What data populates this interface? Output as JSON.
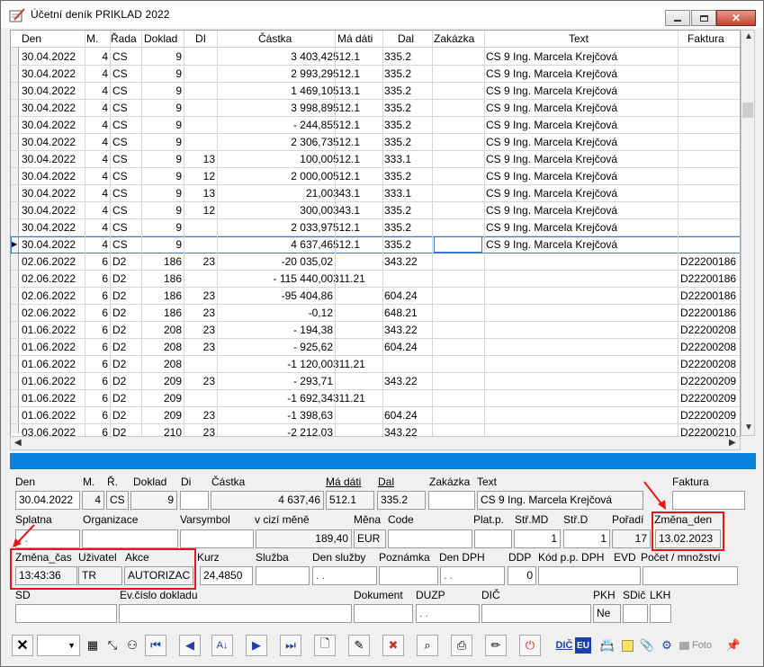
{
  "window": {
    "title": "Účetní deník  PRIKLAD    2022"
  },
  "grid": {
    "columns": [
      "Den",
      "M.",
      "Řada",
      "Doklad",
      "DI",
      "Částka",
      "Má dáti",
      "Dal",
      "Zakázka",
      "Text",
      "Faktura"
    ],
    "rows": [
      [
        "30.04.2022",
        "4",
        "CS",
        "9",
        "",
        "3 403,42",
        "512.1",
        "335.2",
        "",
        "CS 9 Ing. Marcela Krejčová",
        ""
      ],
      [
        "30.04.2022",
        "4",
        "CS",
        "9",
        "",
        "2 993,29",
        "512.1",
        "335.2",
        "",
        "CS 9 Ing. Marcela Krejčová",
        ""
      ],
      [
        "30.04.2022",
        "4",
        "CS",
        "9",
        "",
        "1 469,10",
        "513.1",
        "335.2",
        "",
        "CS 9 Ing. Marcela Krejčová",
        ""
      ],
      [
        "30.04.2022",
        "4",
        "CS",
        "9",
        "",
        "3 998,89",
        "512.1",
        "335.2",
        "",
        "CS 9 Ing. Marcela Krejčová",
        ""
      ],
      [
        "30.04.2022",
        "4",
        "CS",
        "9",
        "",
        "- 244,85",
        "512.1",
        "335.2",
        "",
        "CS 9 Ing. Marcela Krejčová",
        ""
      ],
      [
        "30.04.2022",
        "4",
        "CS",
        "9",
        "",
        "2 306,73",
        "512.1",
        "335.2",
        "",
        "CS 9 Ing. Marcela Krejčová",
        ""
      ],
      [
        "30.04.2022",
        "4",
        "CS",
        "9",
        "13",
        "100,00",
        "512.1",
        "333.1",
        "",
        "CS 9 Ing. Marcela Krejčová",
        ""
      ],
      [
        "30.04.2022",
        "4",
        "CS",
        "9",
        "12",
        "2 000,00",
        "512.1",
        "335.2",
        "",
        "CS 9 Ing. Marcela Krejčová",
        ""
      ],
      [
        "30.04.2022",
        "4",
        "CS",
        "9",
        "13",
        "21,00",
        "343.1",
        "333.1",
        "",
        "CS 9 Ing. Marcela Krejčová",
        ""
      ],
      [
        "30.04.2022",
        "4",
        "CS",
        "9",
        "12",
        "300,00",
        "343.1",
        "335.2",
        "",
        "CS 9 Ing. Marcela Krejčová",
        ""
      ],
      [
        "30.04.2022",
        "4",
        "CS",
        "9",
        "",
        "2 033,97",
        "512.1",
        "335.2",
        "",
        "CS 9 Ing. Marcela Krejčová",
        ""
      ],
      [
        "30.04.2022",
        "4",
        "CS",
        "9",
        "",
        "4 637,46",
        "512.1",
        "335.2",
        "",
        "CS 9 Ing. Marcela Krejčová",
        ""
      ],
      [
        "02.06.2022",
        "6",
        "D2",
        "186",
        "23",
        "-20 035,02",
        "",
        "343.22",
        "",
        "",
        "D22200186"
      ],
      [
        "02.06.2022",
        "6",
        "D2",
        "186",
        "",
        "- 115 440,00",
        "311.21",
        "",
        "",
        "",
        "D22200186"
      ],
      [
        "02.06.2022",
        "6",
        "D2",
        "186",
        "23",
        "-95 404,86",
        "",
        "604.24",
        "",
        "",
        "D22200186"
      ],
      [
        "02.06.2022",
        "6",
        "D2",
        "186",
        "23",
        "-0,12",
        "",
        "648.21",
        "",
        "",
        "D22200186"
      ],
      [
        "01.06.2022",
        "6",
        "D2",
        "208",
        "23",
        "- 194,38",
        "",
        "343.22",
        "",
        "",
        "D22200208"
      ],
      [
        "01.06.2022",
        "6",
        "D2",
        "208",
        "23",
        "- 925,62",
        "",
        "604.24",
        "",
        "",
        "D22200208"
      ],
      [
        "01.06.2022",
        "6",
        "D2",
        "208",
        "",
        "-1 120,00",
        "311.21",
        "",
        "",
        "",
        "D22200208"
      ],
      [
        "01.06.2022",
        "6",
        "D2",
        "209",
        "23",
        "- 293,71",
        "",
        "343.22",
        "",
        "",
        "D22200209"
      ],
      [
        "01.06.2022",
        "6",
        "D2",
        "209",
        "",
        "-1 692,34",
        "311.21",
        "",
        "",
        "",
        "D22200209"
      ],
      [
        "01.06.2022",
        "6",
        "D2",
        "209",
        "23",
        "-1 398,63",
        "",
        "604.24",
        "",
        "",
        "D22200209"
      ],
      [
        "03.06.2022",
        "6",
        "D2",
        "210",
        "23",
        "-2 212,03",
        "",
        "343.22",
        "",
        "",
        "D22200210"
      ]
    ],
    "current_row_index": 11
  },
  "form": {
    "labels": {
      "den": "Den",
      "m": "M.",
      "r": "Ř.",
      "doklad": "Doklad",
      "di": "Di",
      "castka": "Částka",
      "madati": "Má dáti",
      "dal": "Dal",
      "zakazka": "Zakázka",
      "text": "Text",
      "faktura": "Faktura",
      "splatna": "Splatna",
      "organizace": "Organizace",
      "varsymbol": "Varsymbol",
      "vcizimene": "v cizí měně",
      "mena": "Měna",
      "code": "Code",
      "platp": "Plat.p.",
      "strmd": "Stř.MD",
      "strd": "Stř.D",
      "poradi": "Pořadí",
      "zmena_den": "Změna_den",
      "zmena_cas": "Změna_čas",
      "uzivatel": "Uživatel",
      "akce": "Akce",
      "kurz": "Kurz",
      "sluzba": "Služba",
      "den_sluzby": "Den služby",
      "poznamka": "Poznámka",
      "den_dph": "Den DPH",
      "ddp": "DDP",
      "kod_pp_dph": "Kód p.p. DPH",
      "evd": "EVD",
      "pocet": "Počet / množství",
      "sd": "SD",
      "evcislo": "Ev.číslo dokladu",
      "dokument": "Dokument",
      "duzp": "DUZP",
      "dic": "DIČ",
      "pkh": "PKH",
      "sdic": "SDič",
      "lkh": "LKH"
    },
    "values": {
      "den": "30.04.2022",
      "m": "4",
      "r": "CS",
      "doklad": "9",
      "di": "",
      "castka": "4 637,46",
      "madati": "512.1",
      "dal": "335.2",
      "zakazka": "",
      "text": "CS 9 Ing. Marcela Krejčová",
      "faktura": "",
      "splatna": ".  .",
      "organizace": "",
      "varsymbol": "",
      "vcizimene": "189,40",
      "mena": "EUR",
      "code": "",
      "platp": "",
      "strmd": "1",
      "strd": "1",
      "poradi": "17",
      "zmena_den": "13.02.2023",
      "zmena_cas": "13:43:36",
      "uzivatel": "TR",
      "akce": "AUTORIZAC",
      "kurz": "24,4850",
      "sluzba": "",
      "den_sluzby": ".  .",
      "poznamka": "",
      "den_dph": ".  .",
      "ddp": "0",
      "kod_pp_dph": "",
      "pocet": "",
      "sd": "",
      "evcislo": "",
      "dokument": "",
      "duzp": ".  .",
      "dic": "",
      "pkh": "Ne",
      "sdic": "",
      "lkh": ""
    }
  },
  "toolbar": {
    "foto_label": "Foto",
    "dic_label": "DIČ",
    "eu_label": "EU"
  },
  "colors": {
    "accent_bar": "#0a82dc",
    "highlight": "#e01818"
  }
}
